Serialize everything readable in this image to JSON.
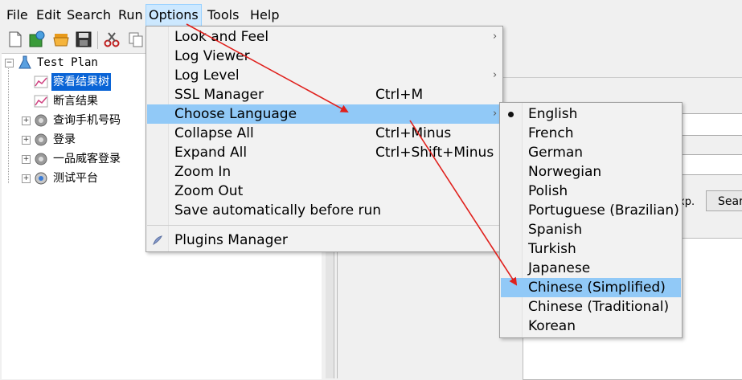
{
  "menubar": {
    "items": [
      "File",
      "Edit",
      "Search",
      "Run",
      "Options",
      "Tools",
      "Help"
    ]
  },
  "toolbar": {
    "icons": [
      "new-icon",
      "templates-icon",
      "open-icon",
      "save-icon",
      "cut-icon",
      "copy-icon"
    ]
  },
  "tree": {
    "root": "Test Plan",
    "items": [
      "察看结果树",
      "断言结果",
      "查询手机号码",
      "登录",
      "一品威客登录",
      "测试平台"
    ]
  },
  "options_menu": {
    "items": [
      {
        "label": "Look and Feel",
        "submenu": true
      },
      {
        "label": "Log Viewer"
      },
      {
        "label": "Log Level",
        "submenu": true
      },
      {
        "label": "SSL Manager",
        "shortcut": "Ctrl+M"
      },
      {
        "label": "Choose Language",
        "submenu": true
      },
      {
        "label": "Collapse All",
        "shortcut": "Ctrl+Minus"
      },
      {
        "label": "Expand All",
        "shortcut": "Ctrl+Shift+Minus"
      },
      {
        "label": "Zoom In"
      },
      {
        "label": "Zoom Out"
      },
      {
        "label": "Save automatically before run"
      },
      {
        "label": "Plugins Manager"
      }
    ]
  },
  "language_menu": {
    "items": [
      "English",
      "French",
      "German",
      "Norwegian",
      "Polish",
      "Portuguese (Brazilian)",
      "Spanish",
      "Turkish",
      "Japanese",
      "Chinese (Simplified)",
      "Chinese (Traditional)",
      "Korean"
    ],
    "selected": "English",
    "highlighted": "Chinese (Simplified)"
  },
  "right_partial": {
    "label_fragment": "xp.",
    "button_fragment": "Sear"
  },
  "colors": {
    "highlight": "#91c9f7",
    "menubar_active": "#cce8ff",
    "tree_selected": "#0a64d6",
    "annotation_arrow": "#e0201c"
  }
}
